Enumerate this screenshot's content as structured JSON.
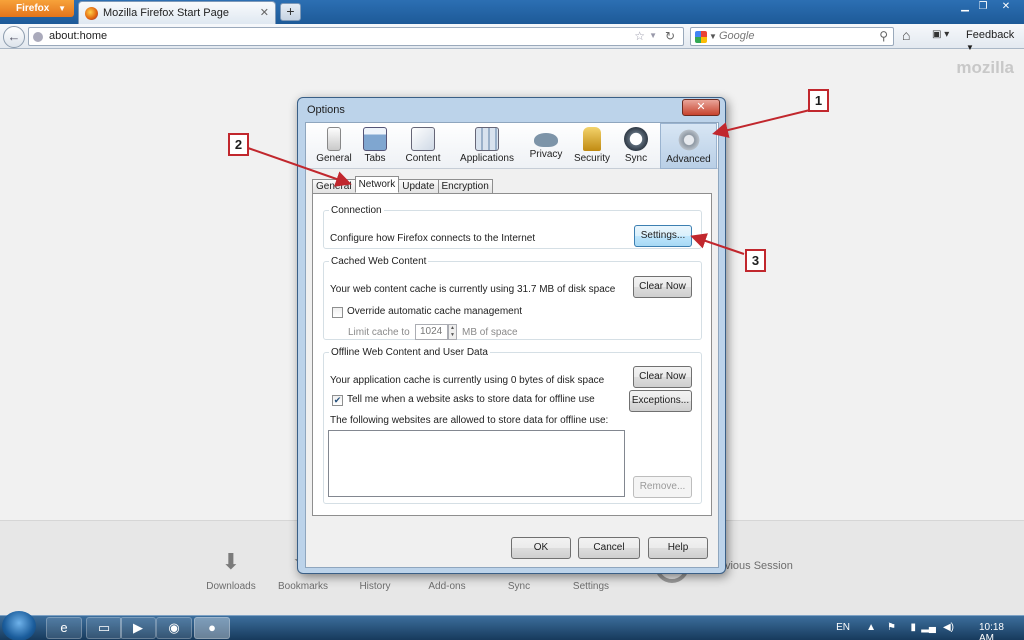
{
  "browser": {
    "menu_button": "Firefox",
    "tab_title": "Mozilla Firefox Start Page",
    "new_tab": "+",
    "url": "about:home",
    "search_placeholder": "Google",
    "feedback": "Feedback"
  },
  "start_page": {
    "brand": "mozilla",
    "launcher": [
      {
        "label": "Downloads",
        "icon": "download-icon"
      },
      {
        "label": "Bookmarks",
        "icon": "bookmark-icon"
      },
      {
        "label": "History",
        "icon": "history-icon"
      },
      {
        "label": "Add-ons",
        "icon": "addons-icon"
      },
      {
        "label": "Sync",
        "icon": "sync-icon"
      },
      {
        "label": "Settings",
        "icon": "gear-icon"
      }
    ],
    "restore_fragment": "re Previous Session"
  },
  "dialog": {
    "title": "Options",
    "panes": [
      {
        "label": "General",
        "icon": "switch-icon",
        "selected": false
      },
      {
        "label": "Tabs",
        "icon": "tabs-icon",
        "selected": false
      },
      {
        "label": "Content",
        "icon": "content-icon",
        "selected": false
      },
      {
        "label": "Applications",
        "icon": "applications-icon",
        "selected": false
      },
      {
        "label": "Privacy",
        "icon": "mask-icon",
        "selected": false
      },
      {
        "label": "Security",
        "icon": "lock-icon",
        "selected": false
      },
      {
        "label": "Sync",
        "icon": "sync-icon",
        "selected": false
      },
      {
        "label": "Advanced",
        "icon": "gear-icon",
        "selected": true
      }
    ],
    "subtabs": [
      "General",
      "Network",
      "Update",
      "Encryption"
    ],
    "selected_subtab": "Network",
    "connection": {
      "legend": "Connection",
      "text": "Configure how Firefox connects to the Internet",
      "button": "Settings..."
    },
    "cache": {
      "legend": "Cached Web Content",
      "text": "Your web content cache is currently using 31.7 MB of disk space",
      "button": "Clear Now",
      "override_label": "Override automatic cache management",
      "override_checked": false,
      "limit_label": "Limit cache to",
      "limit_value": "1024",
      "limit_unit": "MB of space"
    },
    "offline": {
      "legend": "Offline Web Content and User Data",
      "text": "Your application cache is currently using 0 bytes of disk space",
      "clear_button": "Clear Now",
      "tell_label": "Tell me when a website asks to store data for offline use",
      "tell_checked": true,
      "exceptions_button": "Exceptions...",
      "list_label": "The following websites are allowed to store data for offline use:",
      "remove_button": "Remove..."
    },
    "buttons": {
      "ok": "OK",
      "cancel": "Cancel",
      "help": "Help"
    }
  },
  "annotations": [
    "1",
    "2",
    "3"
  ],
  "annotation_color": "#c1272d",
  "taskbar": {
    "language": "EN",
    "clock": "10:18 AM"
  }
}
